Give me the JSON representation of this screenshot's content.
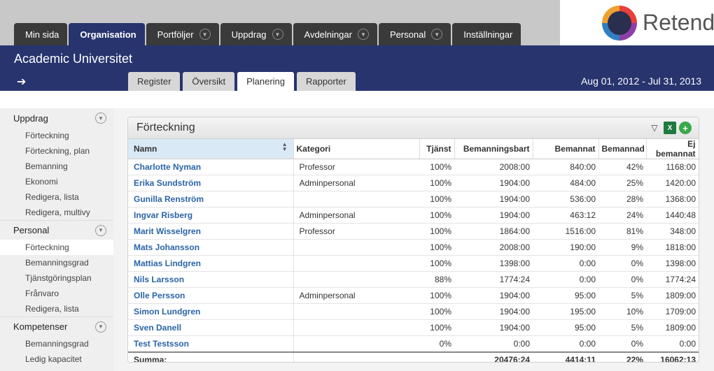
{
  "brand": {
    "logo_text": "Retend"
  },
  "main_tabs": [
    {
      "label": "Min sida",
      "dropdown": false,
      "active": false
    },
    {
      "label": "Organisation",
      "dropdown": false,
      "active": true
    },
    {
      "label": "Portföljer",
      "dropdown": true,
      "active": false
    },
    {
      "label": "Uppdrag",
      "dropdown": true,
      "active": false
    },
    {
      "label": "Avdelningar",
      "dropdown": true,
      "active": false
    },
    {
      "label": "Personal",
      "dropdown": true,
      "active": false
    },
    {
      "label": "Inställningar",
      "dropdown": false,
      "active": false
    }
  ],
  "header": {
    "org_name": "Academic Universitet",
    "date_range": "Aug 01, 2012 - Jul 31, 2013",
    "back_icon": "arrow-left-icon"
  },
  "sub_tabs": [
    {
      "label": "Register",
      "active": false
    },
    {
      "label": "Översikt",
      "active": false
    },
    {
      "label": "Planering",
      "active": true
    },
    {
      "label": "Rapporter",
      "active": false
    }
  ],
  "sidebar": {
    "sections": [
      {
        "label": "Uppdrag",
        "items": [
          "Förteckning",
          "Förteckning, plan",
          "Bemanning",
          "Ekonomi",
          "Redigera, lista",
          "Redigera, multivy"
        ]
      },
      {
        "label": "Personal",
        "items": [
          "Förteckning",
          "Bemanningsgrad",
          "Tjänstgöringsplan",
          "Frånvaro",
          "Redigera, lista"
        ]
      },
      {
        "label": "Kompetenser",
        "items": [
          "Bemanningsgrad",
          "Ledig kapacitet"
        ]
      }
    ],
    "active_item": "Personal/Förteckning"
  },
  "panel": {
    "title": "Förteckning",
    "icons": [
      "filter-icon",
      "excel-export-icon",
      "add-icon"
    ],
    "columns": [
      "Namn",
      "Kategori",
      "Tjänst",
      "Bemanningsbart",
      "Bemannat",
      "Bemannad",
      "Ej bemannat"
    ],
    "rows": [
      [
        "Charlotte Nyman",
        "Professor",
        "100%",
        "2008:00",
        "840:00",
        "42%",
        "1168:00"
      ],
      [
        "Erika Sundström",
        "Adminpersonal",
        "100%",
        "1904:00",
        "484:00",
        "25%",
        "1420:00"
      ],
      [
        "Gunilla Renström",
        "",
        "100%",
        "1904:00",
        "536:00",
        "28%",
        "1368:00"
      ],
      [
        "Ingvar Risberg",
        "Adminpersonal",
        "100%",
        "1904:00",
        "463:12",
        "24%",
        "1440:48"
      ],
      [
        "Marit Wisselgren",
        "Professor",
        "100%",
        "1864:00",
        "1516:00",
        "81%",
        "348:00"
      ],
      [
        "Mats Johansson",
        "",
        "100%",
        "2008:00",
        "190:00",
        "9%",
        "1818:00"
      ],
      [
        "Mattias Lindgren",
        "",
        "100%",
        "1398:00",
        "0:00",
        "0%",
        "1398:00"
      ],
      [
        "Nils Larsson",
        "",
        "88%",
        "1774:24",
        "0:00",
        "0%",
        "1774:24"
      ],
      [
        "Olle Persson",
        "Adminpersonal",
        "100%",
        "1904:00",
        "95:00",
        "5%",
        "1809:00"
      ],
      [
        "Simon Lundgren",
        "",
        "100%",
        "1904:00",
        "195:00",
        "10%",
        "1709:00"
      ],
      [
        "Sven Danell",
        "",
        "100%",
        "1904:00",
        "95:00",
        "5%",
        "1809:00"
      ],
      [
        "Test Testsson",
        "",
        "0%",
        "0:00",
        "0:00",
        "0%",
        "0:00"
      ]
    ],
    "summary": {
      "label": "Summa:",
      "bemanningsbart": "20476:24",
      "bemannat": "4414:11",
      "bemannad": "22%",
      "ej_bemannat": "16062:13"
    }
  }
}
